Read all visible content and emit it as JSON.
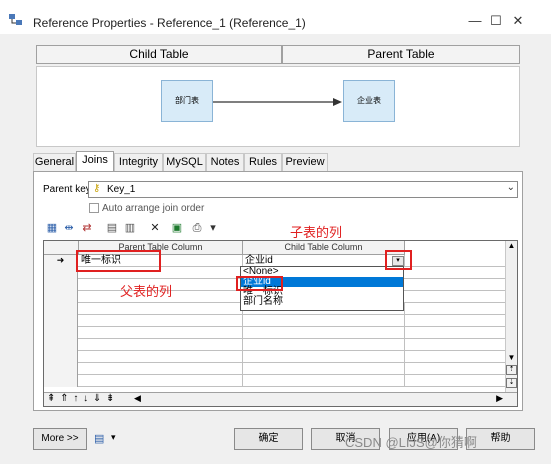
{
  "window": {
    "title": "Reference Properties - Reference_1 (Reference_1)",
    "minimize_glyph": "—",
    "maximize_glyph": "☐",
    "close_glyph": "✕"
  },
  "diagram": {
    "child_header": "Child Table",
    "parent_header": "Parent Table",
    "child_table": "部门表",
    "parent_table": "企业表"
  },
  "tabs": [
    "General",
    "Joins",
    "Integrity",
    "MySQL",
    "Notes",
    "Rules",
    "Preview"
  ],
  "joins": {
    "parent_key_label": "Parent key:",
    "parent_key_value": "Key_1",
    "auto_arrange_label": "Auto arrange join order",
    "columns": [
      "Parent Table Column",
      "Child Table Column"
    ],
    "row": {
      "marker": "➜",
      "parent": "唯一标识",
      "child": "企业id"
    },
    "dropdown": [
      "<None>",
      "企业id",
      "唯一标识",
      "部门名称"
    ],
    "dropdown_selected": "企业id",
    "nav_arrows": "⇞ ⇑ ↑ ↓ ⇓ ⇟"
  },
  "annotations": {
    "child_col": "子表的列",
    "parent_col": "父表的列"
  },
  "buttons": {
    "more": "More >>",
    "ok": "确定",
    "cancel": "取消",
    "apply": "应用(A)",
    "help": "帮助"
  },
  "watermark": "CSDN @LIJS@你猜啊",
  "colors": {
    "annotation": "#e02020",
    "selection": "#0078d7",
    "table_fill": "#d8ebf8"
  }
}
